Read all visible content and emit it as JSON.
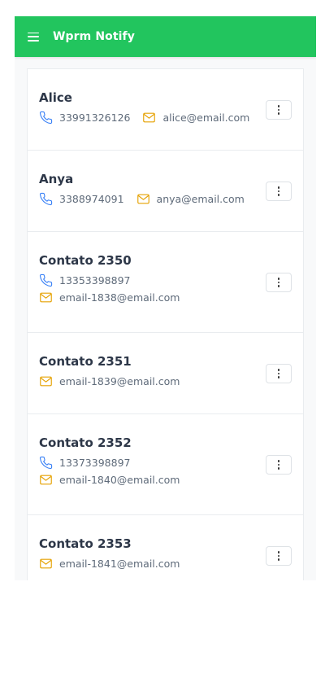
{
  "header": {
    "title": "Wprm Notify"
  },
  "contacts": [
    {
      "name": "Alice",
      "phone": "33991326126",
      "email": "alice@email.com"
    },
    {
      "name": "Anya",
      "phone": "3388974091",
      "email": "anya@email.com"
    },
    {
      "name": "Contato 2350",
      "phone": "13353398897",
      "email": "email-1838@email.com"
    },
    {
      "name": "Contato 2351",
      "email": "email-1839@email.com"
    },
    {
      "name": "Contato 2352",
      "phone": "13373398897",
      "email": "email-1840@email.com"
    },
    {
      "name": "Contato 2353",
      "email": "email-1841@email.com"
    }
  ],
  "icons": {
    "menu": "menu-icon",
    "phone": "phone-icon",
    "email": "mail-icon",
    "more": "kebab-menu-icon"
  },
  "colors": {
    "header_bg": "#22c55e",
    "phone_icon": "#3b82f6",
    "mail_icon": "#e5a100"
  }
}
